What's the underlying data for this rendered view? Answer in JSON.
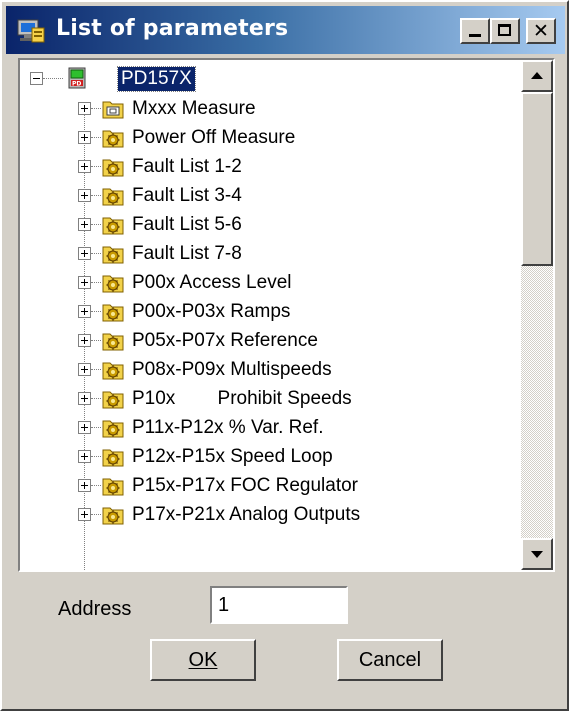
{
  "window": {
    "title": "List of parameters",
    "colors": {
      "titlebar_start": "#0a246a",
      "titlebar_end": "#a6caf0",
      "selection": "#0a246a",
      "face": "#d4d0c8"
    }
  },
  "tree": {
    "root": {
      "label": "PD157X",
      "icon": "device-icon",
      "expanded": true,
      "selected": true
    },
    "items": [
      {
        "label": "Mxxx Measure",
        "icon": "folder-measure-icon"
      },
      {
        "label": "Power Off Measure",
        "icon": "folder-gear-icon"
      },
      {
        "label": "Fault List 1-2",
        "icon": "folder-gear-icon"
      },
      {
        "label": "Fault List 3-4",
        "icon": "folder-gear-icon"
      },
      {
        "label": "Fault List 5-6",
        "icon": "folder-gear-icon"
      },
      {
        "label": "Fault List 7-8",
        "icon": "folder-gear-icon"
      },
      {
        "label": "P00x Access Level",
        "icon": "folder-gear-icon"
      },
      {
        "label": "P00x-P03x Ramps",
        "icon": "folder-gear-icon"
      },
      {
        "label": "P05x-P07x Reference",
        "icon": "folder-gear-icon"
      },
      {
        "label": "P08x-P09x Multispeeds",
        "icon": "folder-gear-icon"
      },
      {
        "label": "P10x        Prohibit Speeds",
        "icon": "folder-gear-icon"
      },
      {
        "label": "P11x-P12x % Var. Ref.",
        "icon": "folder-gear-icon"
      },
      {
        "label": "P12x-P15x Speed Loop",
        "icon": "folder-gear-icon"
      },
      {
        "label": "P15x-P17x FOC Regulator",
        "icon": "folder-gear-icon"
      },
      {
        "label": "P17x-P21x Analog Outputs",
        "icon": "folder-gear-icon"
      }
    ]
  },
  "form": {
    "address_label": "Address",
    "address_value": "1",
    "ok_label": "OK",
    "cancel_label": "Cancel"
  }
}
